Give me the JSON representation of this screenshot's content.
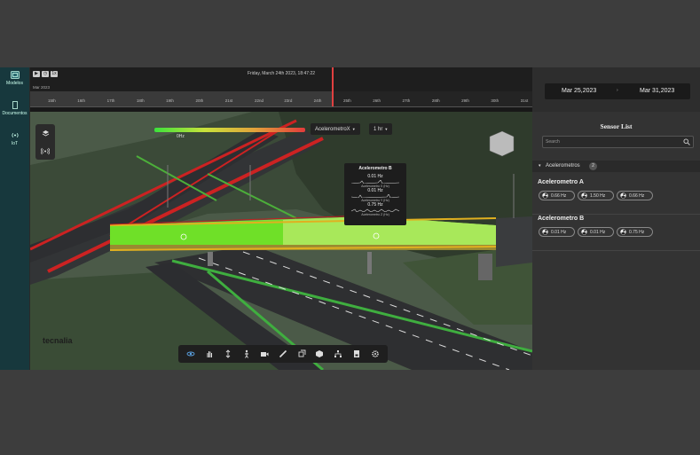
{
  "rail": {
    "items": [
      {
        "label": "Modelos",
        "icon": "model-icon"
      },
      {
        "label": "Documentos",
        "icon": "document-icon"
      },
      {
        "label": "IoT",
        "icon": "iot-icon"
      }
    ]
  },
  "timeline": {
    "datetime": "Friday, March 24th 2023, 18:47:22",
    "month": "Mar 2023",
    "ticks": [
      "15th",
      "16th",
      "17th",
      "18th",
      "19th",
      "20th",
      "21st",
      "22nd",
      "23rd",
      "24th",
      "25th",
      "26th",
      "27th",
      "28th",
      "29th",
      "30th",
      "31st"
    ],
    "controls": [
      "play",
      "back",
      "1x"
    ]
  },
  "viewport": {
    "legend_label": "0Hz",
    "channel_select": "AcelerometroX",
    "range_select": "1 hr",
    "watermark": "tecnalia",
    "popup": {
      "title": "Acelerometro B",
      "readings": [
        {
          "value": "0.01 Hz",
          "label": "Acelerometro X (Hz)"
        },
        {
          "value": "0.01 Hz",
          "label": "Acelerometro Y (Hz)"
        },
        {
          "value": "0.75 Hz",
          "label": "Acelerometro Z (Hz)"
        }
      ]
    },
    "bottom_tools": [
      "orbit-icon",
      "pan-icon",
      "elevation-icon",
      "walk-icon",
      "camera-icon",
      "measure-icon",
      "section-icon",
      "object-icon",
      "tree-icon",
      "save-icon",
      "settings-icon"
    ]
  },
  "panel": {
    "date_from": "Mar 25,2023",
    "date_sep": "›",
    "date_to": "Mar 31,2023",
    "title": "Sensor List",
    "search_placeholder": "Search",
    "group_label": "Acelerometros",
    "group_count": "2",
    "sensors": [
      {
        "name": "Acelerometro A",
        "values": [
          "0.66 Hz",
          "1.50 Hz",
          "0.66 Hz"
        ]
      },
      {
        "name": "Acelerometro B",
        "values": [
          "0.01 Hz",
          "0.01 Hz",
          "0.75 Hz"
        ]
      }
    ]
  },
  "colors": {
    "accent": "#2a6a70",
    "heat_low": "#3be23b",
    "heat_high": "#e23b3b",
    "rail": "#17383d"
  }
}
